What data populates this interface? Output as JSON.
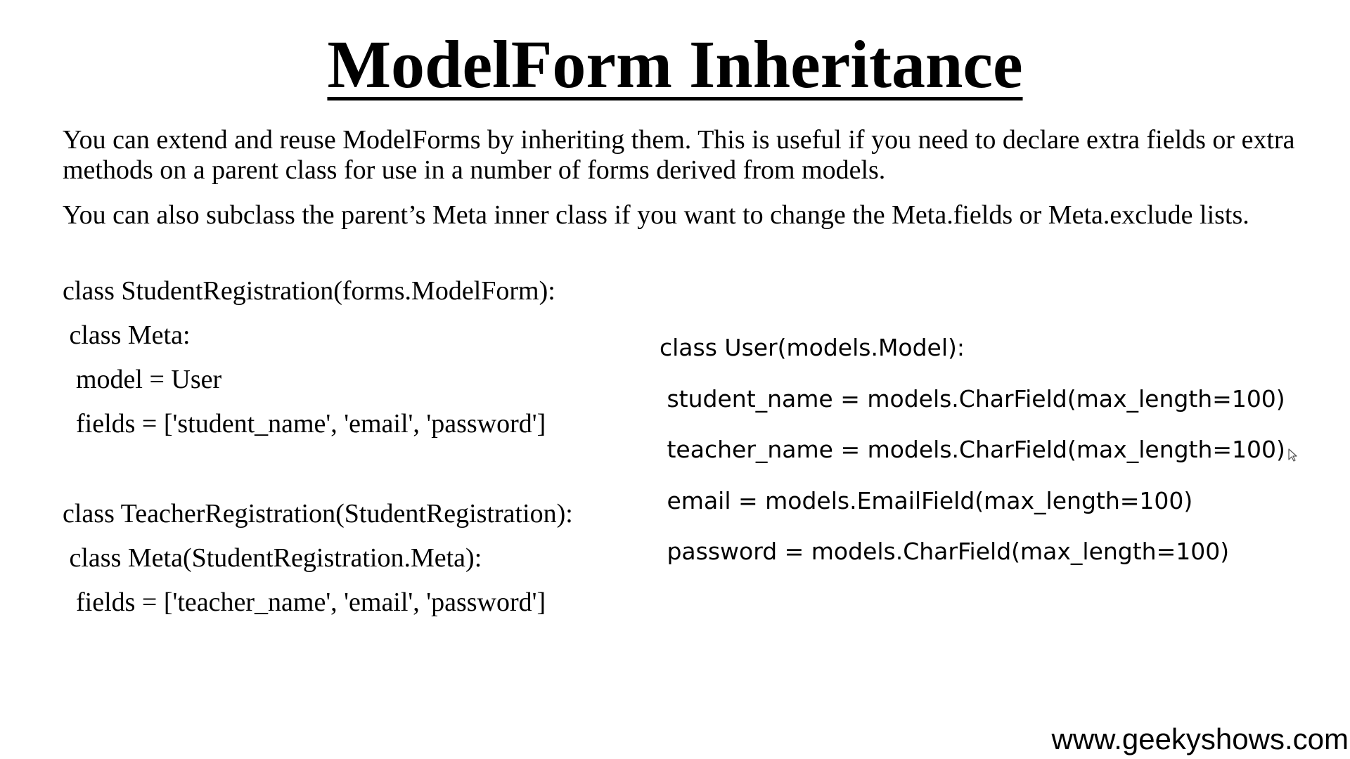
{
  "title": "ModelForm Inheritance",
  "paragraphs": [
    "You can extend and reuse ModelForms by inheriting them. This is useful if you need to declare extra fields or extra methods on a parent class for use in a number of forms derived from models.",
    "You can also subclass the parent’s Meta inner class if you want to change the Meta.fields or Meta.exclude lists."
  ],
  "code_left": [
    "class StudentRegistration(forms.ModelForm):",
    " class Meta:",
    "  model = User",
    "  fields = ['student_name', 'email', 'password']",
    "class TeacherRegistration(StudentRegistration):",
    " class Meta(StudentRegistration.Meta):",
    "  fields = ['teacher_name', 'email', 'password']"
  ],
  "code_right": [
    "class User(models.Model):",
    " student_name = models.CharField(max_length=100)",
    " teacher_name = models.CharField(max_length=100)",
    " email = models.EmailField(max_length=100)",
    " password = models.CharField(max_length=100)"
  ],
  "footer": "www.geekyshows.com",
  "icons": {
    "cursor": "mouse-pointer-icon"
  }
}
